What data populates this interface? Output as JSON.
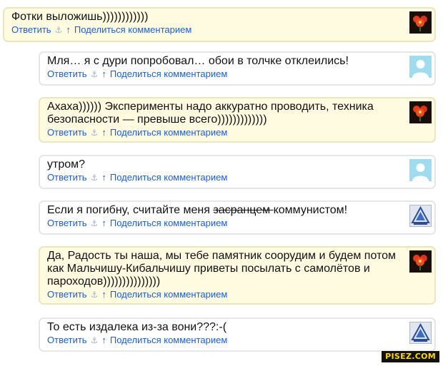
{
  "actions": {
    "reply": "Ответить",
    "anchor_icon": "anchor-icon",
    "up_icon": "arrow-up-icon",
    "share": "Поделиться комментарием"
  },
  "comments": [
    {
      "text": "Фотки выложишь))))))))))))",
      "style": "yellow",
      "avatar": "red-flower"
    },
    {
      "text": "Мля… я с дури попробовал… обои в толчке отклеились!",
      "style": "white",
      "avatar": "default-user"
    },
    {
      "text": "Ахаха)))))) Эксперименты надо аккуратно проводить, техника безопасности — превыше всего)))))))))))))",
      "style": "yellow",
      "avatar": "red-flower"
    },
    {
      "text": "утром?",
      "style": "white",
      "avatar": "default-user"
    },
    {
      "text_before": "Если я погибну, считайте меня ",
      "text_struck": "засранцем ",
      "text_after": "коммунистом!",
      "style": "white",
      "avatar": "blue-logo"
    },
    {
      "text": "Да, Радость ты наша, мы тебе памятник соорудим и будем потом как Мальчишу-Кибальчишу приветы посылать с самолётов и пароходов)))))))))))))))",
      "style": "yellow",
      "avatar": "red-flower"
    },
    {
      "text": "То есть издалека из-за вони???:-(",
      "style": "white",
      "avatar": "blue-logo"
    }
  ],
  "watermark": "PISEZ.COM",
  "colors": {
    "link": "#1a5fd6",
    "highlight_bg": "#fffbe0",
    "border": "#e6e6e6"
  }
}
